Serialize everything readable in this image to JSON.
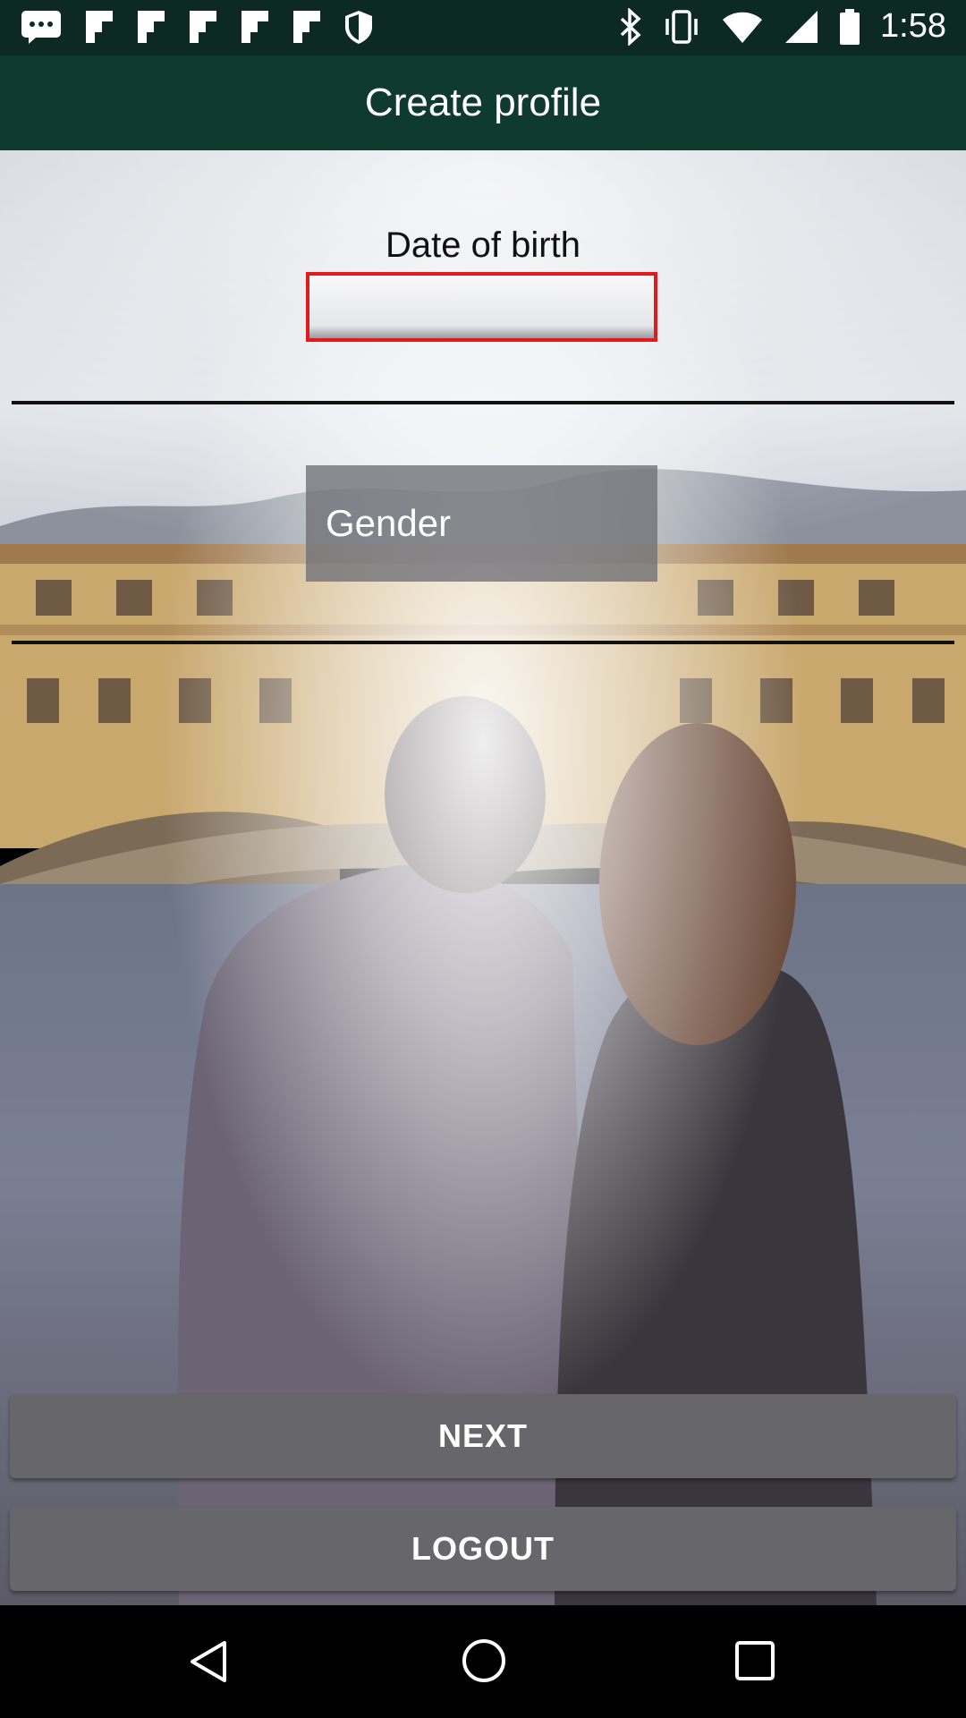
{
  "status_bar": {
    "time": "1:58",
    "left_icons": [
      "message-icon",
      "flipboard-icon",
      "flipboard-icon",
      "flipboard-icon",
      "flipboard-icon",
      "flipboard-icon",
      "shield-icon"
    ],
    "right_icons": [
      "bluetooth-icon",
      "vibrate-icon",
      "wifi-icon",
      "signal-icon",
      "battery-icon"
    ]
  },
  "app_bar": {
    "title": "Create profile"
  },
  "form": {
    "dob_label": "Date of birth",
    "dob_value": "",
    "gender_placeholder": "Gender"
  },
  "buttons": {
    "next": "NEXT",
    "logout": "LOGOUT"
  },
  "nav_bar": {
    "icons": [
      "back-icon",
      "home-icon",
      "recents-icon"
    ]
  },
  "colors": {
    "app_bar_bg": "#0f3a2e",
    "status_bar_bg": "#0c2a22",
    "focus_border": "#e01b1b",
    "button_bg": "#66666b"
  }
}
